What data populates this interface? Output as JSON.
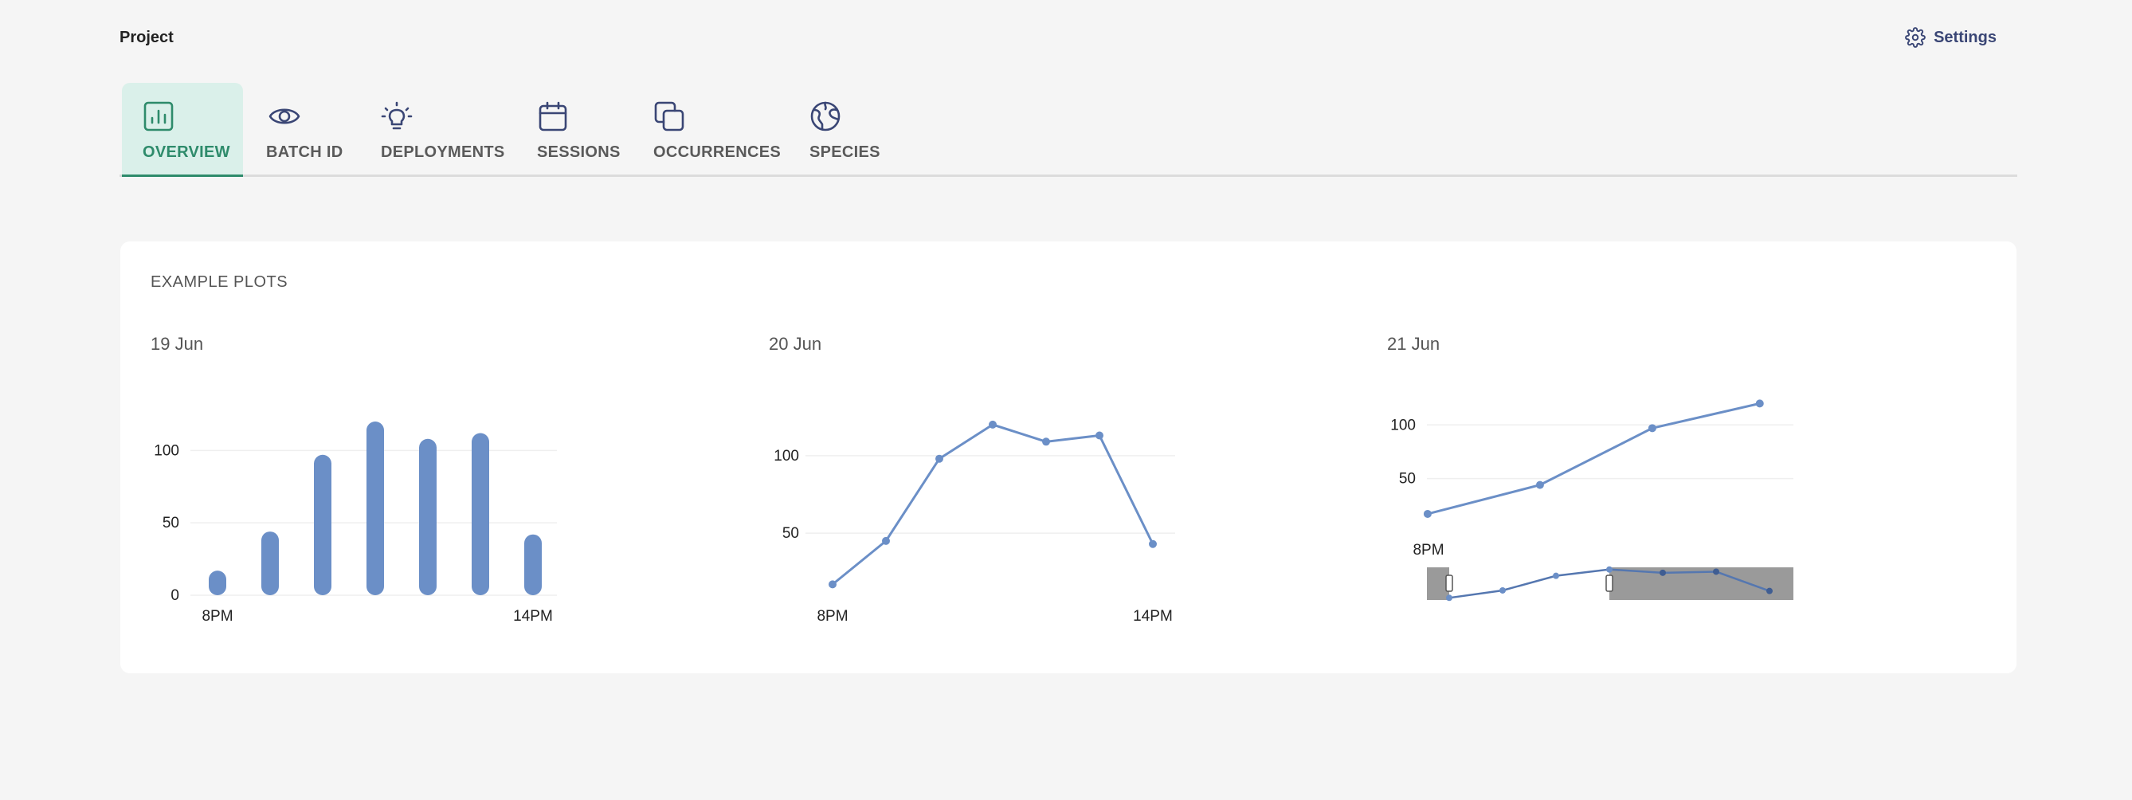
{
  "header": {
    "project_title": "Project",
    "settings_label": "Settings"
  },
  "tabs": [
    {
      "label": "OVERVIEW",
      "icon": "bar-chart-icon",
      "active": true
    },
    {
      "label": "BATCH ID",
      "icon": "eye-icon",
      "active": false
    },
    {
      "label": "DEPLOYMENTS",
      "icon": "lightbulb-icon",
      "active": false
    },
    {
      "label": "SESSIONS",
      "icon": "calendar-icon",
      "active": false
    },
    {
      "label": "OCCURRENCES",
      "icon": "copy-icon",
      "active": false
    },
    {
      "label": "SPECIES",
      "icon": "globe-icon",
      "active": false
    }
  ],
  "colors": {
    "accent": "#2e8b6b",
    "accent_bg": "#daf0ea",
    "series": "#6b8fc7",
    "nav": "#3a4675"
  },
  "card": {
    "title": "EXAMPLE PLOTS"
  },
  "chart_data": [
    {
      "type": "bar",
      "title": "19 Jun",
      "x": [
        1,
        2,
        3,
        4,
        5,
        6,
        7
      ],
      "values": [
        17,
        44,
        97,
        120,
        108,
        112,
        42
      ],
      "x_tick_labels": [
        "8PM",
        "14PM"
      ],
      "y_ticks": [
        0,
        50,
        100
      ],
      "ylim": [
        0,
        120
      ],
      "grid": true
    },
    {
      "type": "line",
      "title": "20 Jun",
      "x": [
        1,
        2,
        3,
        4,
        5,
        6,
        7
      ],
      "values": [
        17,
        45,
        98,
        120,
        109,
        113,
        43
      ],
      "x_tick_labels": [
        "8PM",
        "14PM"
      ],
      "y_ticks": [
        50,
        100
      ],
      "ylim": [
        10,
        122
      ],
      "grid": true
    },
    {
      "type": "line",
      "title": "21 Jun",
      "x": [
        0.7,
        3.0,
        5.3,
        7.5
      ],
      "values": [
        17,
        44,
        97,
        120
      ],
      "x_tick_labels": [
        "8PM"
      ],
      "y_ticks": [
        50,
        100
      ],
      "ylim": [
        14,
        124
      ],
      "grid": true,
      "range_selector": {
        "x": [
          1,
          2,
          3,
          4,
          5,
          6,
          7
        ],
        "values": [
          17,
          44,
          97,
          120,
          108,
          112,
          42
        ],
        "selected_range": [
          1,
          4
        ]
      }
    }
  ]
}
